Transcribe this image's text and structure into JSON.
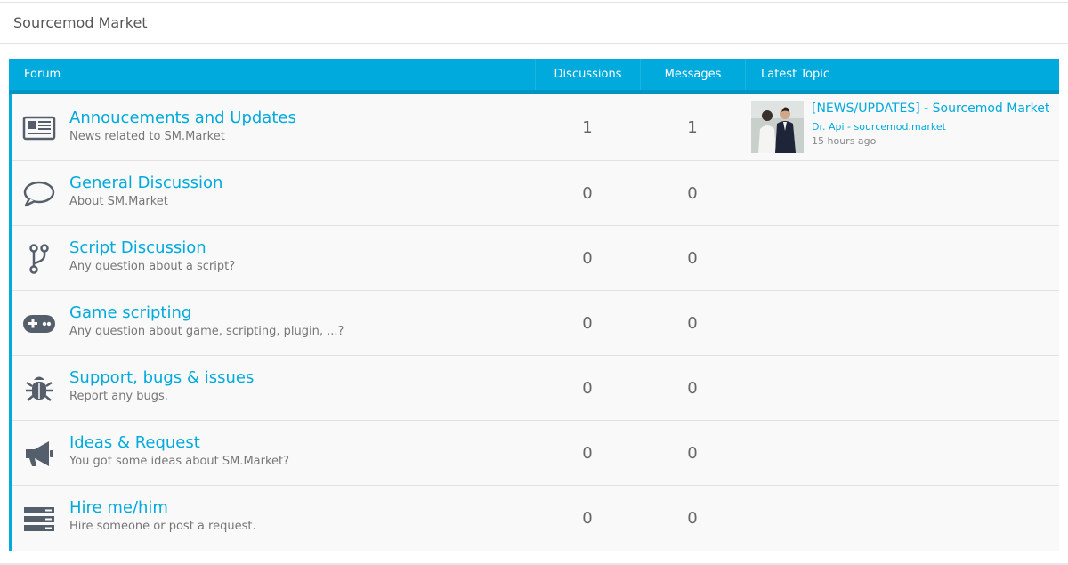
{
  "page": {
    "title": "Sourcemod Market"
  },
  "table": {
    "headers": {
      "forum": "Forum",
      "discussions": "Discussions",
      "messages": "Messages",
      "latest": "Latest Topic"
    },
    "rows": [
      {
        "icon": "newspaper-icon",
        "name": "Annoucements and Updates",
        "description": "News related to SM.Market",
        "discussions": "1",
        "messages": "1",
        "latest": {
          "title": "[NEWS/UPDATES] - Sourcemod Market",
          "author": "Dr. Api - sourcemod.market",
          "time": "15 hours ago"
        }
      },
      {
        "icon": "speech-bubble-icon",
        "name": "General Discussion",
        "description": "About SM.Market",
        "discussions": "0",
        "messages": "0"
      },
      {
        "icon": "code-fork-icon",
        "name": "Script Discussion",
        "description": "Any question about a script?",
        "discussions": "0",
        "messages": "0"
      },
      {
        "icon": "gamepad-icon",
        "name": "Game scripting",
        "description": "Any question about game, scripting, plugin, ...?",
        "discussions": "0",
        "messages": "0"
      },
      {
        "icon": "bug-icon",
        "name": "Support, bugs & issues",
        "description": "Report any bugs.",
        "discussions": "0",
        "messages": "0"
      },
      {
        "icon": "megaphone-icon",
        "name": "Ideas & Request",
        "description": "You got some ideas about SM.Market?",
        "discussions": "0",
        "messages": "0"
      },
      {
        "icon": "server-list-icon",
        "name": "Hire me/him",
        "description": "Hire someone or post a request.",
        "discussions": "0",
        "messages": "0"
      }
    ]
  },
  "colors": {
    "accent": "#00aadd",
    "header_bar": "#00aadd",
    "icon": "#555f6b"
  }
}
